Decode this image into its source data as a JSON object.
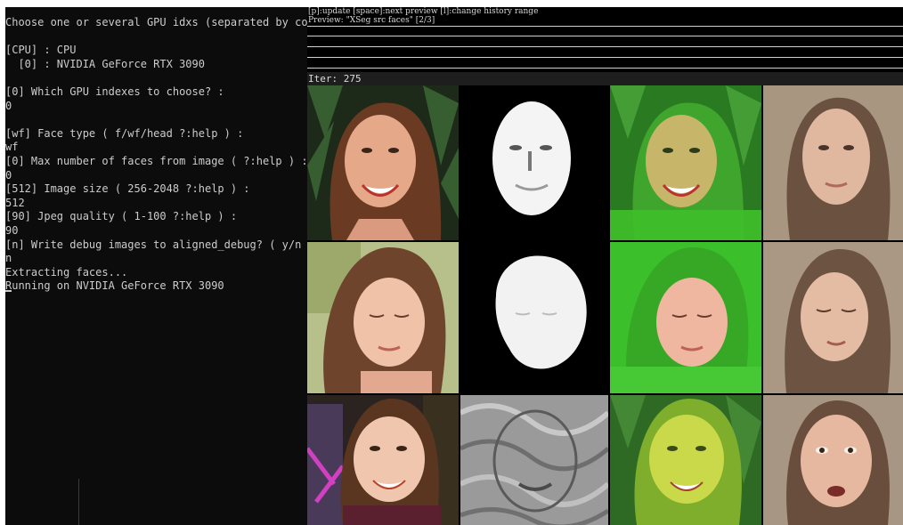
{
  "terminal": {
    "lines": [
      "Choose one or several GPU idxs (separated by comma",
      "",
      "[CPU] : CPU",
      "  [0] : NVIDIA GeForce RTX 3090",
      "",
      "[0] Which GPU indexes to choose? :",
      "0",
      "",
      "[wf] Face type ( f/wf/head ?:help ) :",
      "wf",
      "[0] Max number of faces from image ( ?:help ) :",
      "0",
      "[512] Image size ( 256-2048 ?:help ) :",
      "512",
      "[90] Jpeg quality ( 1-100 ?:help ) :",
      "90",
      "[n] Write debug images to aligned_debug? ( y/n ) :",
      "n",
      "Extracting faces...",
      "Running on NVIDIA GeForce RTX 3090"
    ]
  },
  "preview": {
    "help_text": "[p]:update [space]:next preview [l]:change history range",
    "preview_label": "Preview: \"XSeg src faces\" [2/3]",
    "iter_label": "Iter: 275"
  },
  "grid": {
    "columns": [
      "src-photo",
      "mask",
      "overlay",
      "reconstruction"
    ],
    "rows": 3
  },
  "colors": {
    "terminal_bg": "#0c0c0c",
    "terminal_fg": "#cccccc",
    "overlay_green": "#3fbf2a",
    "mask_white": "#ffffff"
  }
}
